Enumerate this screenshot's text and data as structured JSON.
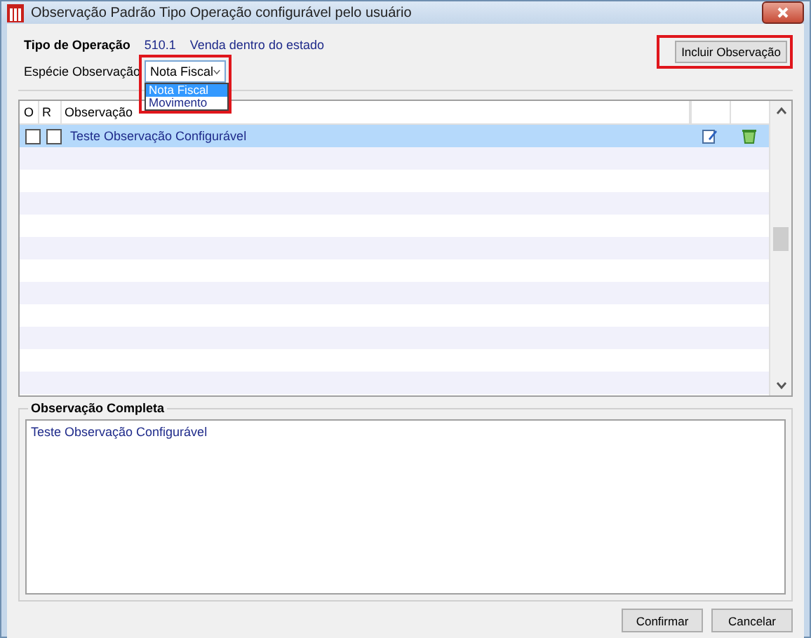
{
  "window": {
    "title": "Observação Padrão Tipo Operação configurável pelo usuário"
  },
  "operation": {
    "label": "Tipo de Operação",
    "code": "510.1",
    "description": "Venda dentro do estado"
  },
  "kind_field": {
    "label": "Espécie Observação",
    "value": "Nota Fiscal",
    "options": [
      {
        "label": "Nota Fiscal",
        "selected": true
      },
      {
        "label": "Movimento",
        "selected": false
      }
    ]
  },
  "add_button": "Incluir Observação",
  "table": {
    "columns": [
      "O",
      "R",
      "Observação"
    ],
    "rows": [
      {
        "o": false,
        "r": false,
        "text": "Teste Observação Configurável",
        "selected": true
      }
    ]
  },
  "full_note": {
    "title": "Observação Completa",
    "text": "Teste Observação Configurável"
  },
  "buttons": [
    "Confirmar",
    "Cancelar"
  ]
}
